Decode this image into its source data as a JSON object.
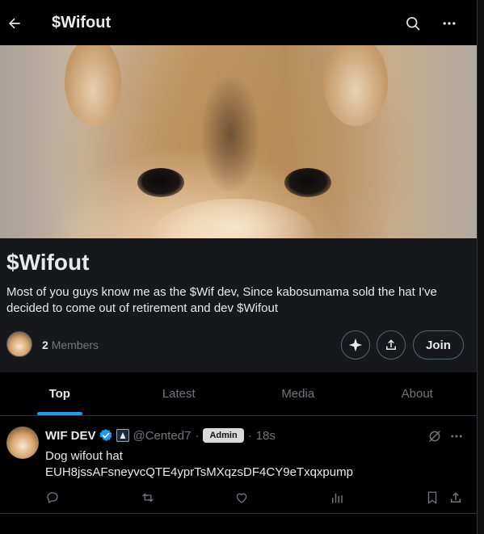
{
  "header": {
    "title": "$Wifout",
    "back_icon": "arrow-left-icon",
    "search_icon": "search-icon",
    "more_icon": "more-horizontal-icon"
  },
  "banner": {
    "description": "dog face cover image"
  },
  "community": {
    "name": "$Wifout",
    "description": "Most of you guys know me as the $Wif dev, Since kabosumama sold the hat I've decided to come out of retirement and dev $Wifout",
    "member_count": "2",
    "members_label": "Members",
    "join_label": "Join"
  },
  "tabs": [
    {
      "label": "Top",
      "active": true
    },
    {
      "label": "Latest",
      "active": false
    },
    {
      "label": "Media",
      "active": false
    },
    {
      "label": "About",
      "active": false
    }
  ],
  "post": {
    "author": "WIF DEV",
    "handle": "@Cented7",
    "separator": "·",
    "badge": "Admin",
    "time": "18s",
    "text_line1": "Dog wifout hat",
    "text_line2": "EUH8jssAFsneyvcQTE4yprTsMXqzsDF4CY9eTxqxpump"
  },
  "colors": {
    "accent": "#1d9bf0",
    "background": "#000000",
    "panel": "#16181c",
    "muted_text": "#71767b",
    "text": "#e7e9ea"
  }
}
